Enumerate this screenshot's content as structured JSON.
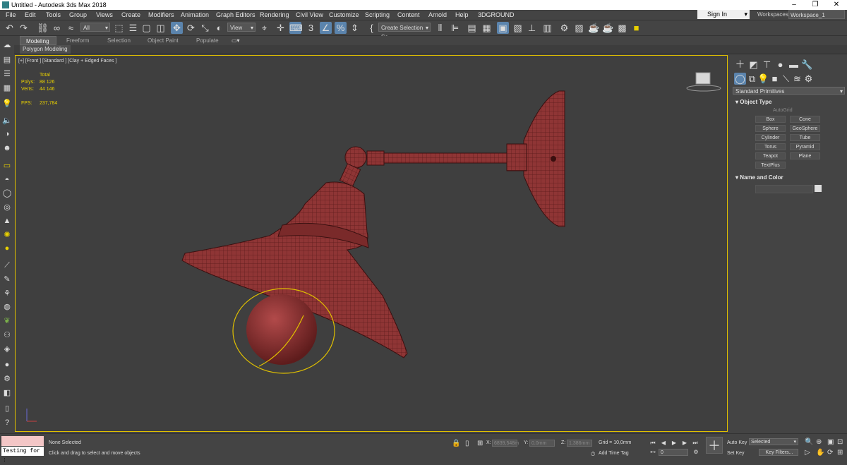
{
  "window": {
    "title": "Untitled - Autodesk 3ds Max 2018",
    "minimize": "–",
    "maximize": "❐",
    "close": "✕"
  },
  "menu": [
    "File",
    "Edit",
    "Tools",
    "Group",
    "Views",
    "Create",
    "Modifiers",
    "Animation",
    "Graph Editors",
    "Rendering",
    "Civil View",
    "Customize",
    "Scripting",
    "Content",
    "Arnold",
    "Help",
    "3DGROUND"
  ],
  "account": {
    "sign_in": "Sign In",
    "workspaces_label": "Workspaces:",
    "workspace": "Workspace_1"
  },
  "toolbar": {
    "filter": "All",
    "view": "View",
    "selection_set": "Create Selection Se",
    "snap_3": "3"
  },
  "ribbon": {
    "tabs": [
      "Modeling",
      "Freeform",
      "Selection",
      "Object Paint",
      "Populate"
    ],
    "active": "Modeling",
    "sub": "Polygon Modeling"
  },
  "viewport": {
    "label": "[+] [Front ] [Standard ] [Clay + Edged Faces ]",
    "stats": {
      "total_label": "Total",
      "polys_label": "Polys:",
      "polys": "88 126",
      "verts_label": "Verts:",
      "verts": "44 146",
      "fps_label": "FPS:",
      "fps": "237,784"
    }
  },
  "command_panel": {
    "category": "Standard Primitives",
    "object_type_title": "Object Type",
    "autogrid": "AutoGrid",
    "buttons": [
      "Box",
      "Cone",
      "Sphere",
      "GeoSphere",
      "Cylinder",
      "Tube",
      "Torus",
      "Pyramid",
      "Teapot",
      "Plane",
      "TextPlus"
    ],
    "name_color_title": "Name and Color"
  },
  "status": {
    "script_listener": "Testing for :",
    "selected": "None Selected",
    "prompt": "Click and drag to select and move objects",
    "x_label": "X:",
    "x_value": "6839,548m",
    "y_label": "Y:",
    "y_value": "0,0mm",
    "z_label": "Z:",
    "z_value": "1,386mm",
    "grid": "Grid = 10,0mm",
    "add_time_tag": "Add Time Tag",
    "auto_key": "Auto Key",
    "set_key": "Set Key",
    "selected_dropdown": "Selected",
    "key_filters": "Key Filters...",
    "frame": "0"
  },
  "colors": {
    "selection": "#e0c000",
    "model": "#8a2f2f",
    "active_tool": "#5b84ad"
  }
}
